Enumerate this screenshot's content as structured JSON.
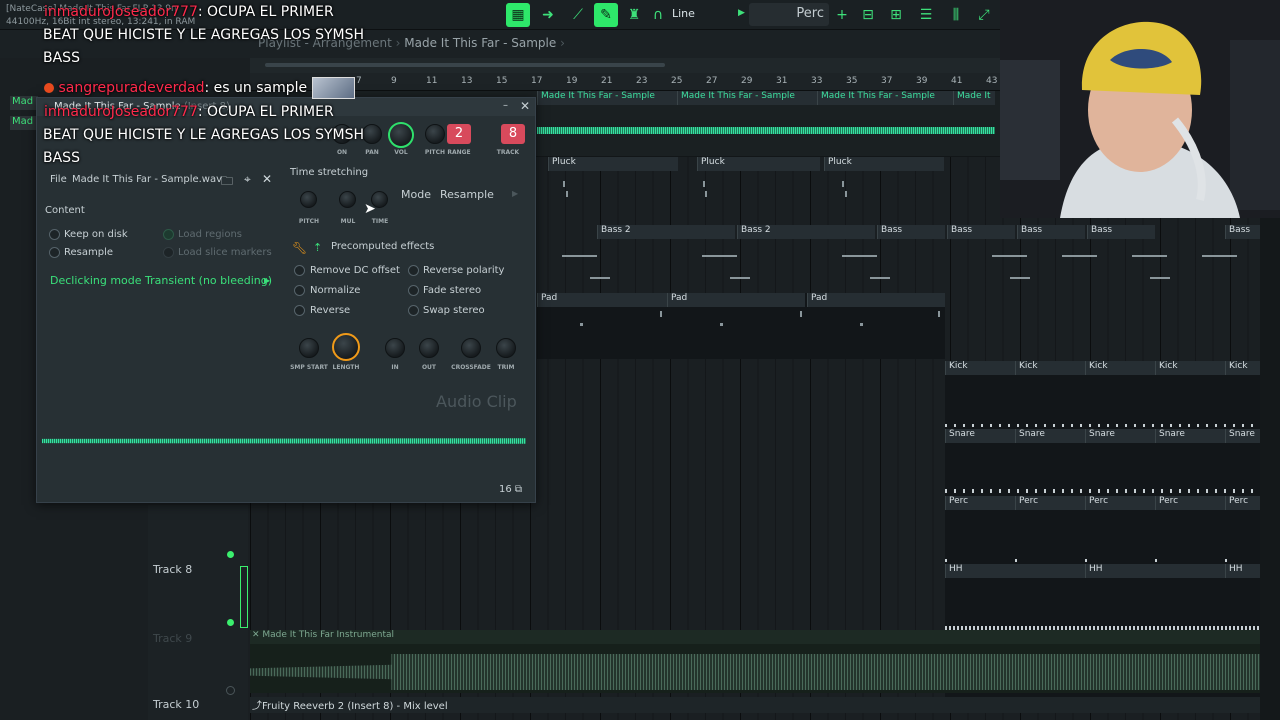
{
  "app": {
    "info_lines": [
      "[NateCase] Made It This Far.FLP 13.9n",
      "44100Hz, 16Bit int stereo, 13:241, in RAM"
    ],
    "snap_mode": "Line",
    "pattern_name": "Perc"
  },
  "playlist": {
    "breadcrumb_prefix": "Playlist - Arrangement",
    "breadcrumb_current": "Made It This Far - Sample",
    "ruler_ticks": [
      "7",
      "9",
      "11",
      "13",
      "15",
      "17",
      "19",
      "21",
      "23",
      "25",
      "27",
      "29",
      "31",
      "33",
      "35",
      "37",
      "39",
      "41",
      "43"
    ],
    "tracks": [
      {
        "name": "Track 8"
      },
      {
        "name": "Track 9"
      },
      {
        "name": "Track 10"
      }
    ],
    "clips": {
      "sample": "Made It This Far - Sample",
      "sample_short": "Made It",
      "pluck": "Pluck",
      "bass2": "Bass 2",
      "bass": "Bass",
      "pad": "Pad",
      "kick": "Kick",
      "snare": "Snare",
      "perc": "Perc",
      "hh": "HH",
      "instrumental": "Made It This Far Instrumental",
      "automation": "Fruity Reeverb 2 (Insert 8) - Mix level"
    },
    "left_tags": [
      "Mad",
      "Mad"
    ]
  },
  "sampler": {
    "title": "Made It This Far - Sample",
    "title_suffix": "(Insert 8)",
    "knob_labels": [
      "ON",
      "PAN",
      "VOL",
      "PITCH",
      "RANGE",
      "TRACK"
    ],
    "range_value": "2",
    "track_value": "8",
    "file_label": "File",
    "file_name": "Made It This Far - Sample.wav",
    "time_stretching_label": "Time stretching",
    "ts_knobs": [
      "PITCH",
      "MUL",
      "TIME"
    ],
    "mode_label": "Mode",
    "mode_value": "Resample",
    "content_label": "Content",
    "content_options": [
      "Keep on disk",
      "Resample",
      "Load regions",
      "Load slice markers"
    ],
    "declicking_label": "Declicking mode",
    "declicking_value": "Transient (no bleeding)",
    "precomputed_label": "Precomputed effects",
    "effects_left": [
      "Remove DC offset",
      "Normalize",
      "Reverse"
    ],
    "effects_right": [
      "Reverse polarity",
      "Fade stereo",
      "Swap stereo"
    ],
    "bottom_knobs": [
      "SMP START",
      "LENGTH",
      "IN",
      "OUT",
      "CROSSFADE",
      "TRIM"
    ],
    "audio_clip_label": "Audio Clip",
    "slot_number": "16"
  },
  "chat": [
    {
      "user": "inmaduroJoseador777",
      "text": ": OCUPA EL PRIMER",
      "cont": [
        "BEAT QUE HICISTE Y LE AGREGAS LOS SYMSH",
        "BASS"
      ]
    },
    {
      "user": "sangrepuradeverdad",
      "text": ": es un sample"
    },
    {
      "user": "inmaduroJoseador777",
      "text": ": OCUPA EL PRIMER",
      "cont": [
        "BEAT QUE HICISTE Y LE AGREGAS LOS SYMSH",
        "BASS"
      ]
    }
  ],
  "colors": {
    "accent_green": "#2ee86a",
    "wave_teal": "#37e1a2",
    "knob_orange": "#f09a19",
    "pill_red": "#d84a5c"
  }
}
